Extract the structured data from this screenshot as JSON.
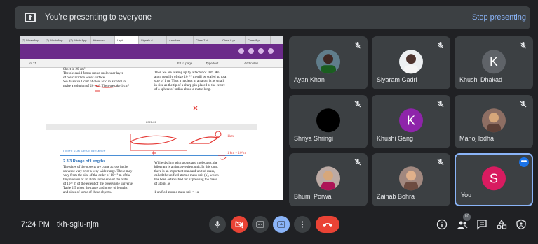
{
  "banner": {
    "message": "You're presenting to everyone",
    "stop_label": "Stop presenting"
  },
  "presentation": {
    "browser_tabs": [
      "(2) WhatsApp",
      "(2) WhatsApp",
      "(2) WhatsApp",
      "Kiran wo...",
      "Leph...",
      "Signals.d...",
      "Aandhan",
      "Class 7 cli",
      "Class 8 pr",
      "Class 8 pr"
    ],
    "toolbar_items": [
      "Fit to page",
      "Type text",
      "Add notes"
    ],
    "page_counter": "of 21",
    "text_blocks": {
      "left_top_1": "Sheet in 20 cm²",
      "left_top_2": "The olelcacid forms mono-molecular layer",
      "left_top_3": "of oleic acid on water surface.",
      "left_top_4": "We dissolve 1 cm³ of oleic acid in alcohol to",
      "left_top_5": "make a solution of 20 cm³. Then we take 1 cm³",
      "right_top_1": "Then we are scaling up by a factor of 10¹⁰. An",
      "right_top_2": "atom roughly of size 10⁻¹⁰ m will be scaled up to a",
      "right_top_3": "size of 1 m. Thus a nucleus in an atom is as small",
      "right_top_4": "in size as the tip of a sharp pin placed at the centre",
      "right_top_5": "of a sphere of radius about a metre long.",
      "page_footer": "2021-22",
      "chapter": "UNITS AND MEASUREMENT",
      "section": "2.3.3  Range of Lengths",
      "left_1": "The sizes of the objects we come across in the",
      "left_2": "universe vary over a very wide range. These may",
      "left_3": "vary from the size of the order of 10⁻¹⁵ m of the",
      "left_4": "tiny nucleus of an atom to the size of the order",
      "left_5": "of 10²⁶ m of the extent of the observable universe.",
      "left_6": "Table 2.5 gives the range and order of lengths",
      "left_7": "and sizes of some of these objects.",
      "right_1": "While dealing with atoms and molecules, the",
      "right_2": "kilogram is an inconvenient unit. In this case,",
      "right_3": "there is an important standard unit of mass,",
      "right_4": "called the unified atomic mass unit (u), which",
      "right_5": "has been established for expressing the mass",
      "right_6": "of atoms as",
      "right_7": "1 unified atomic mass unit = 1u"
    },
    "annotations": {
      "handwritten_1": "1km",
      "handwritten_2": "1 km = 10³ m"
    }
  },
  "participants": [
    {
      "name": "Ayan Khan",
      "type": "photo",
      "muted": true
    },
    {
      "name": "Siyaram Gadri",
      "type": "photo",
      "muted": true
    },
    {
      "name": "Khushi Dhakad",
      "type": "letter",
      "letter": "K",
      "color": "#5f6368",
      "muted": true
    },
    {
      "name": "Shriya Shringi",
      "type": "photo",
      "muted": true
    },
    {
      "name": "Khushi Gang",
      "type": "letter",
      "letter": "K",
      "color": "#8e24aa",
      "muted": true
    },
    {
      "name": "Manoj lodha",
      "type": "photo",
      "muted": true
    },
    {
      "name": "Bhumi Porwal",
      "type": "photo",
      "muted": true
    },
    {
      "name": "Zainab Bohra",
      "type": "photo",
      "muted": true
    },
    {
      "name": "You",
      "type": "letter",
      "letter": "S",
      "color": "#d81b60",
      "muted": false
    }
  ],
  "bottom_bar": {
    "time": "7:24 PM",
    "meeting_code": "tkh-sgiu-njm",
    "participant_count": "10"
  },
  "colors": {
    "background": "#202124",
    "tile": "#3c4043",
    "accent_blue": "#8ab4f8",
    "danger_red": "#ea4335"
  }
}
